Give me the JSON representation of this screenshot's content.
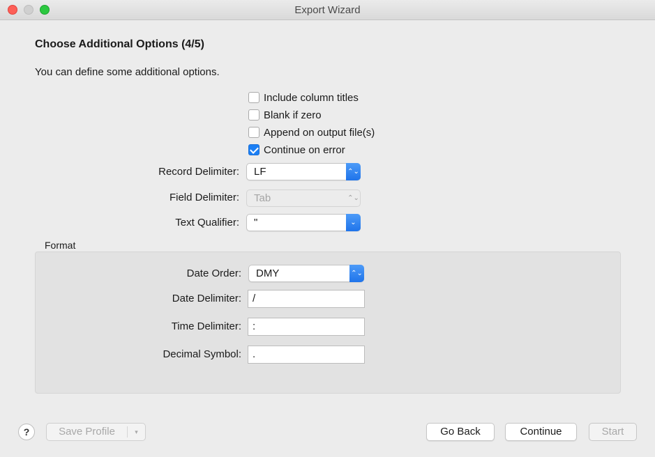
{
  "window": {
    "title": "Export Wizard"
  },
  "page": {
    "heading": "Choose Additional Options (4/5)",
    "intro": "You can define some additional options."
  },
  "options": [
    {
      "label": "Include column titles",
      "checked": false
    },
    {
      "label": "Blank if zero",
      "checked": false
    },
    {
      "label": "Append on output file(s)",
      "checked": false
    },
    {
      "label": "Continue on error",
      "checked": true
    }
  ],
  "delimiters": {
    "record_label": "Record Delimiter:",
    "record_value": "LF",
    "field_label": "Field Delimiter:",
    "field_value": "Tab",
    "qualifier_label": "Text Qualifier:",
    "qualifier_value": "\""
  },
  "format": {
    "group_label": "Format",
    "date_order_label": "Date Order:",
    "date_order_value": "DMY",
    "date_delim_label": "Date Delimiter:",
    "date_delim_value": "/",
    "time_delim_label": "Time Delimiter:",
    "time_delim_value": ":",
    "decimal_label": "Decimal Symbol:",
    "decimal_value": "."
  },
  "footer": {
    "help": "?",
    "save_profile": "Save Profile",
    "save_profile_menu": "▾",
    "go_back": "Go Back",
    "continue": "Continue",
    "start": "Start"
  },
  "icons": {
    "popup_updown": "⌃⌄",
    "popup_down": "⌄"
  },
  "colors": {
    "accent": "#1b7ff5",
    "window_bg": "#ececec",
    "group_bg": "#e2e2e2"
  }
}
